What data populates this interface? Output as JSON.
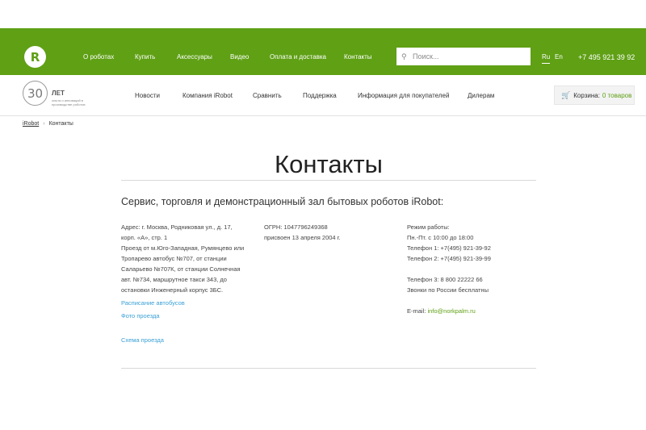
{
  "header": {
    "logo_letter": "R",
    "nav": [
      "О роботах",
      "Купить",
      "Аксессуары",
      "Видео",
      "Оплата и доставка",
      "Контакты"
    ],
    "search_placeholder": "Поиск...",
    "languages": [
      "Ru",
      "En"
    ],
    "active_language": "Ru",
    "phone": "+7 495 921 39 92",
    "brand_color": "#5fa015"
  },
  "subheader": {
    "badge_number": "30",
    "badge_title": "ЛЕТ",
    "badge_subtitle": "опыта и инноваций в производстве роботов",
    "nav": [
      "Новости",
      "Компания iRobot",
      "Сравнить",
      "Поддержка",
      "Информация для покупателей",
      "Дилерам"
    ],
    "cart_label": "Корзина:",
    "cart_count": "0 товаров"
  },
  "breadcrumb": {
    "home": "iRobot",
    "separator": "›",
    "current": "Контакты"
  },
  "page": {
    "title": "Контакты",
    "subtitle": "Сервис, торговля и демонстрационный зал бытовых роботов iRobot:"
  },
  "address_column": {
    "lines": [
      "Адрес: г. Москва, Родниковая ул., д. 17,",
      "корп. «А», стр. 1",
      "Проезд от м.Юго-Западная, Румянцево или",
      "Тропарево автобус №707, от станции",
      "Саларьево №707К, от станции Солнечная",
      "авт. №734, маршрутное такси 343, до",
      "остановки Инженерный корпус 3БС."
    ],
    "bus_schedule_link": "Расписание автобусов",
    "route_photo_link": "Фото проезда",
    "route_map_link": "Схема проезда"
  },
  "registration_column": {
    "lines": [
      "ОГРН: 1047796249368",
      "присвоен 13 апреля 2004 г."
    ]
  },
  "hours_column": {
    "lines": [
      "Режим работы:",
      "Пн.-Пт. с 10:00 до 18:00",
      "Телефон 1: +7(495) 921-39-92",
      "Телефон 2: +7(495) 921-39-99"
    ],
    "phone3": "Телефон 3: 8 800 22222 66",
    "free_calls": "Звонки по России бесплатны",
    "email_label": "E-mail:",
    "email": "info@norkpalm.ru"
  }
}
